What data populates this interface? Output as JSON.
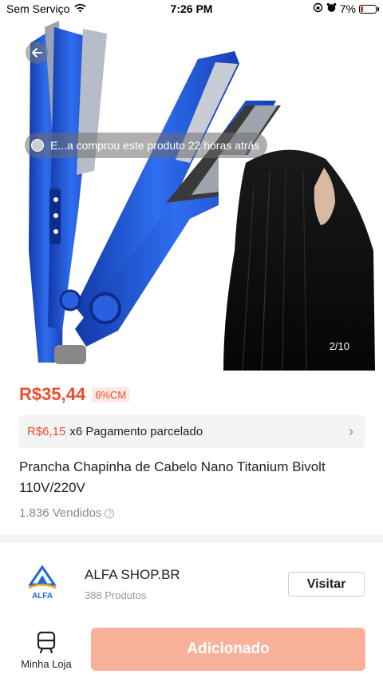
{
  "status_bar": {
    "carrier": "Sem Serviço",
    "time": "7:26 PM",
    "battery": "7%"
  },
  "hero": {
    "toast": "E...a comprou este produto 22 horas atrás",
    "counter": "2/10"
  },
  "product": {
    "price": "R$35,44",
    "discount": "6%CM",
    "installment_amount": "R$6,15",
    "installment_text": "x6 Pagamento parcelado",
    "title": "Prancha Chapinha de Cabelo Nano Titanium Bivolt 110V/220V",
    "sold": "1.836 Vendidos"
  },
  "shop": {
    "name": "ALFA SHOP.BR",
    "products": "388 Produtos",
    "visit_label": "Visitar",
    "logo_text": "ALFA"
  },
  "bottom_bar": {
    "my_store_label": "Minha Loja",
    "add_label": "Adicionado"
  },
  "colors": {
    "accent": "#ee4d2d",
    "added_button": "#f9b19a",
    "flat_iron_blue": "#1f56d6"
  }
}
